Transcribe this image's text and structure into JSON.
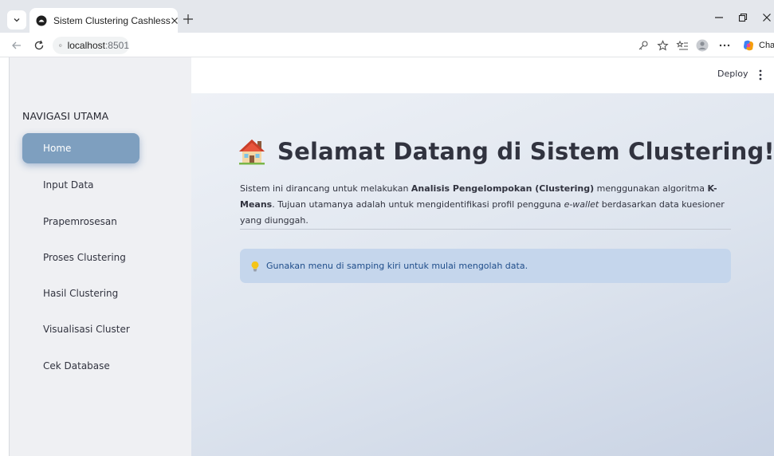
{
  "browser": {
    "tab_title": "Sistem Clustering Cashless",
    "url_host": "localhost",
    "url_port": ":8501",
    "copilot_label": "Chat"
  },
  "app": {
    "deploy_label": "Deploy"
  },
  "sidebar": {
    "heading": "NAVIGASI UTAMA",
    "items": [
      {
        "label": "Home",
        "active": true
      },
      {
        "label": "Input Data",
        "active": false
      },
      {
        "label": "Prapemrosesan",
        "active": false
      },
      {
        "label": "Proses Clustering",
        "active": false
      },
      {
        "label": "Hasil Clustering",
        "active": false
      },
      {
        "label": "Visualisasi Cluster",
        "active": false
      },
      {
        "label": "Cek Database",
        "active": false
      }
    ]
  },
  "main": {
    "title": "Selamat Datang di Sistem Clustering!",
    "title_icon": "house-icon",
    "intro": {
      "p1": "Sistem ini dirancang untuk melakukan ",
      "b1": "Analisis Pengelompokan (Clustering)",
      "p2": " menggunakan algoritma ",
      "b2": "K-Means",
      "p3": ". Tujuan utamanya adalah untuk mengidentifikasi profil pengguna ",
      "i1": "e-wallet",
      "p4": " berdasarkan data kuesioner yang diunggah."
    },
    "info_icon": "lightbulb-icon",
    "info_text": "Gunakan menu di samping kiri untuk mulai mengolah data."
  },
  "colors": {
    "sidebar_active": "#7e9fbf",
    "info_bg": "#c5d6ec",
    "info_text": "#1f4d8a"
  }
}
